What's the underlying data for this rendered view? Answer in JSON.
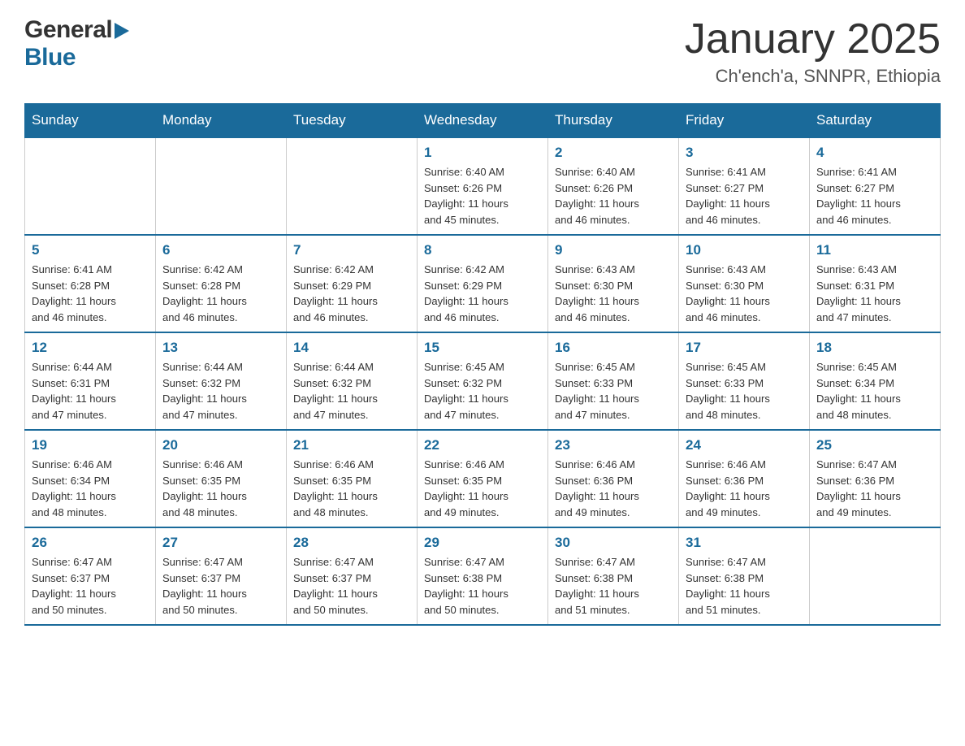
{
  "header": {
    "logo_general": "General",
    "logo_blue": "Blue",
    "month_title": "January 2025",
    "location": "Ch'ench'a, SNNPR, Ethiopia"
  },
  "days_of_week": [
    "Sunday",
    "Monday",
    "Tuesday",
    "Wednesday",
    "Thursday",
    "Friday",
    "Saturday"
  ],
  "weeks": [
    [
      {
        "day": "",
        "info": ""
      },
      {
        "day": "",
        "info": ""
      },
      {
        "day": "",
        "info": ""
      },
      {
        "day": "1",
        "info": "Sunrise: 6:40 AM\nSunset: 6:26 PM\nDaylight: 11 hours\nand 45 minutes."
      },
      {
        "day": "2",
        "info": "Sunrise: 6:40 AM\nSunset: 6:26 PM\nDaylight: 11 hours\nand 46 minutes."
      },
      {
        "day": "3",
        "info": "Sunrise: 6:41 AM\nSunset: 6:27 PM\nDaylight: 11 hours\nand 46 minutes."
      },
      {
        "day": "4",
        "info": "Sunrise: 6:41 AM\nSunset: 6:27 PM\nDaylight: 11 hours\nand 46 minutes."
      }
    ],
    [
      {
        "day": "5",
        "info": "Sunrise: 6:41 AM\nSunset: 6:28 PM\nDaylight: 11 hours\nand 46 minutes."
      },
      {
        "day": "6",
        "info": "Sunrise: 6:42 AM\nSunset: 6:28 PM\nDaylight: 11 hours\nand 46 minutes."
      },
      {
        "day": "7",
        "info": "Sunrise: 6:42 AM\nSunset: 6:29 PM\nDaylight: 11 hours\nand 46 minutes."
      },
      {
        "day": "8",
        "info": "Sunrise: 6:42 AM\nSunset: 6:29 PM\nDaylight: 11 hours\nand 46 minutes."
      },
      {
        "day": "9",
        "info": "Sunrise: 6:43 AM\nSunset: 6:30 PM\nDaylight: 11 hours\nand 46 minutes."
      },
      {
        "day": "10",
        "info": "Sunrise: 6:43 AM\nSunset: 6:30 PM\nDaylight: 11 hours\nand 46 minutes."
      },
      {
        "day": "11",
        "info": "Sunrise: 6:43 AM\nSunset: 6:31 PM\nDaylight: 11 hours\nand 47 minutes."
      }
    ],
    [
      {
        "day": "12",
        "info": "Sunrise: 6:44 AM\nSunset: 6:31 PM\nDaylight: 11 hours\nand 47 minutes."
      },
      {
        "day": "13",
        "info": "Sunrise: 6:44 AM\nSunset: 6:32 PM\nDaylight: 11 hours\nand 47 minutes."
      },
      {
        "day": "14",
        "info": "Sunrise: 6:44 AM\nSunset: 6:32 PM\nDaylight: 11 hours\nand 47 minutes."
      },
      {
        "day": "15",
        "info": "Sunrise: 6:45 AM\nSunset: 6:32 PM\nDaylight: 11 hours\nand 47 minutes."
      },
      {
        "day": "16",
        "info": "Sunrise: 6:45 AM\nSunset: 6:33 PM\nDaylight: 11 hours\nand 47 minutes."
      },
      {
        "day": "17",
        "info": "Sunrise: 6:45 AM\nSunset: 6:33 PM\nDaylight: 11 hours\nand 48 minutes."
      },
      {
        "day": "18",
        "info": "Sunrise: 6:45 AM\nSunset: 6:34 PM\nDaylight: 11 hours\nand 48 minutes."
      }
    ],
    [
      {
        "day": "19",
        "info": "Sunrise: 6:46 AM\nSunset: 6:34 PM\nDaylight: 11 hours\nand 48 minutes."
      },
      {
        "day": "20",
        "info": "Sunrise: 6:46 AM\nSunset: 6:35 PM\nDaylight: 11 hours\nand 48 minutes."
      },
      {
        "day": "21",
        "info": "Sunrise: 6:46 AM\nSunset: 6:35 PM\nDaylight: 11 hours\nand 48 minutes."
      },
      {
        "day": "22",
        "info": "Sunrise: 6:46 AM\nSunset: 6:35 PM\nDaylight: 11 hours\nand 49 minutes."
      },
      {
        "day": "23",
        "info": "Sunrise: 6:46 AM\nSunset: 6:36 PM\nDaylight: 11 hours\nand 49 minutes."
      },
      {
        "day": "24",
        "info": "Sunrise: 6:46 AM\nSunset: 6:36 PM\nDaylight: 11 hours\nand 49 minutes."
      },
      {
        "day": "25",
        "info": "Sunrise: 6:47 AM\nSunset: 6:36 PM\nDaylight: 11 hours\nand 49 minutes."
      }
    ],
    [
      {
        "day": "26",
        "info": "Sunrise: 6:47 AM\nSunset: 6:37 PM\nDaylight: 11 hours\nand 50 minutes."
      },
      {
        "day": "27",
        "info": "Sunrise: 6:47 AM\nSunset: 6:37 PM\nDaylight: 11 hours\nand 50 minutes."
      },
      {
        "day": "28",
        "info": "Sunrise: 6:47 AM\nSunset: 6:37 PM\nDaylight: 11 hours\nand 50 minutes."
      },
      {
        "day": "29",
        "info": "Sunrise: 6:47 AM\nSunset: 6:38 PM\nDaylight: 11 hours\nand 50 minutes."
      },
      {
        "day": "30",
        "info": "Sunrise: 6:47 AM\nSunset: 6:38 PM\nDaylight: 11 hours\nand 51 minutes."
      },
      {
        "day": "31",
        "info": "Sunrise: 6:47 AM\nSunset: 6:38 PM\nDaylight: 11 hours\nand 51 minutes."
      },
      {
        "day": "",
        "info": ""
      }
    ]
  ]
}
